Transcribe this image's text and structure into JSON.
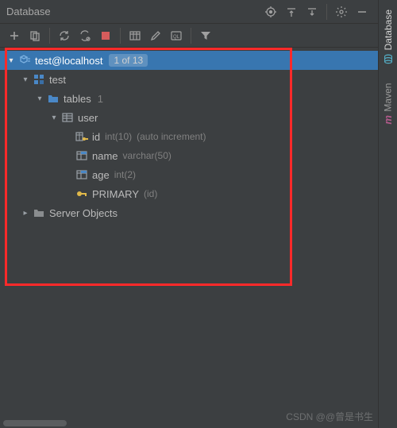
{
  "panel": {
    "title": "Database"
  },
  "toolbar": {},
  "tree": {
    "root": {
      "label": "test@localhost",
      "badge": "1 of 13"
    },
    "schema": {
      "label": "test"
    },
    "tables_group": {
      "label": "tables",
      "count": "1"
    },
    "table": {
      "label": "user"
    },
    "columns": [
      {
        "name": "id",
        "type": "int(10)",
        "extra": "(auto increment)"
      },
      {
        "name": "name",
        "type": "varchar(50)",
        "extra": ""
      },
      {
        "name": "age",
        "type": "int(2)",
        "extra": ""
      }
    ],
    "primary": {
      "label": "PRIMARY",
      "cols": "(id)"
    },
    "server_objects": {
      "label": "Server Objects"
    }
  },
  "sidebar": {
    "tabs": [
      {
        "label": "Database"
      },
      {
        "label": "Maven"
      }
    ]
  },
  "watermark": "CSDN @@曾是书生"
}
